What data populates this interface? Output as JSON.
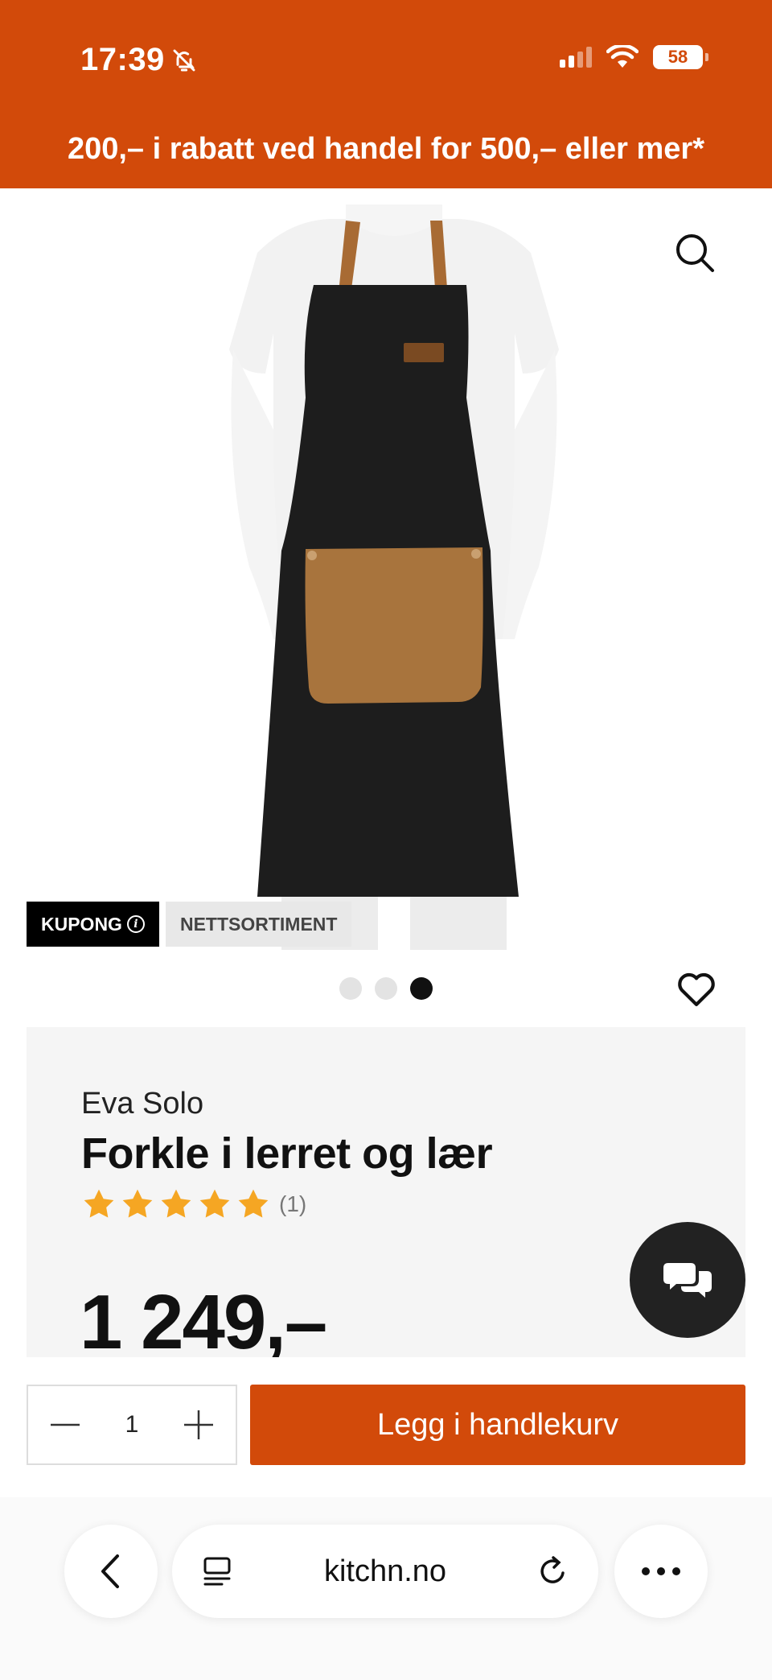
{
  "status_bar": {
    "time": "17:39",
    "battery": "58"
  },
  "promo_banner": {
    "text": "200,– i rabatt ved handel for 500,– eller mer*"
  },
  "badges": {
    "coupon": "KUPONG",
    "web_only": "NETTSORTIMENT"
  },
  "product": {
    "brand": "Eva Solo",
    "title": "Forkle i lerret og lær",
    "rating_stars": 5,
    "rating_count": "(1)",
    "price": "1 249,–"
  },
  "gallery": {
    "image_count": 3,
    "active_index": 3
  },
  "cart": {
    "quantity": "1",
    "add_to_cart_label": "Legg i handlekurv"
  },
  "browser": {
    "url": "kitchn.no"
  },
  "colors": {
    "brand_orange": "#d24a0a",
    "star_gold": "#f5a623",
    "dark": "#111111"
  },
  "icons": [
    "bell-slash-icon",
    "signal-icon",
    "wifi-icon",
    "battery-icon",
    "search-icon",
    "info-icon",
    "heart-icon",
    "star-icon",
    "chat-icon",
    "minus-icon",
    "plus-icon",
    "chevron-left-icon",
    "reader-icon",
    "reload-icon",
    "more-icon"
  ]
}
